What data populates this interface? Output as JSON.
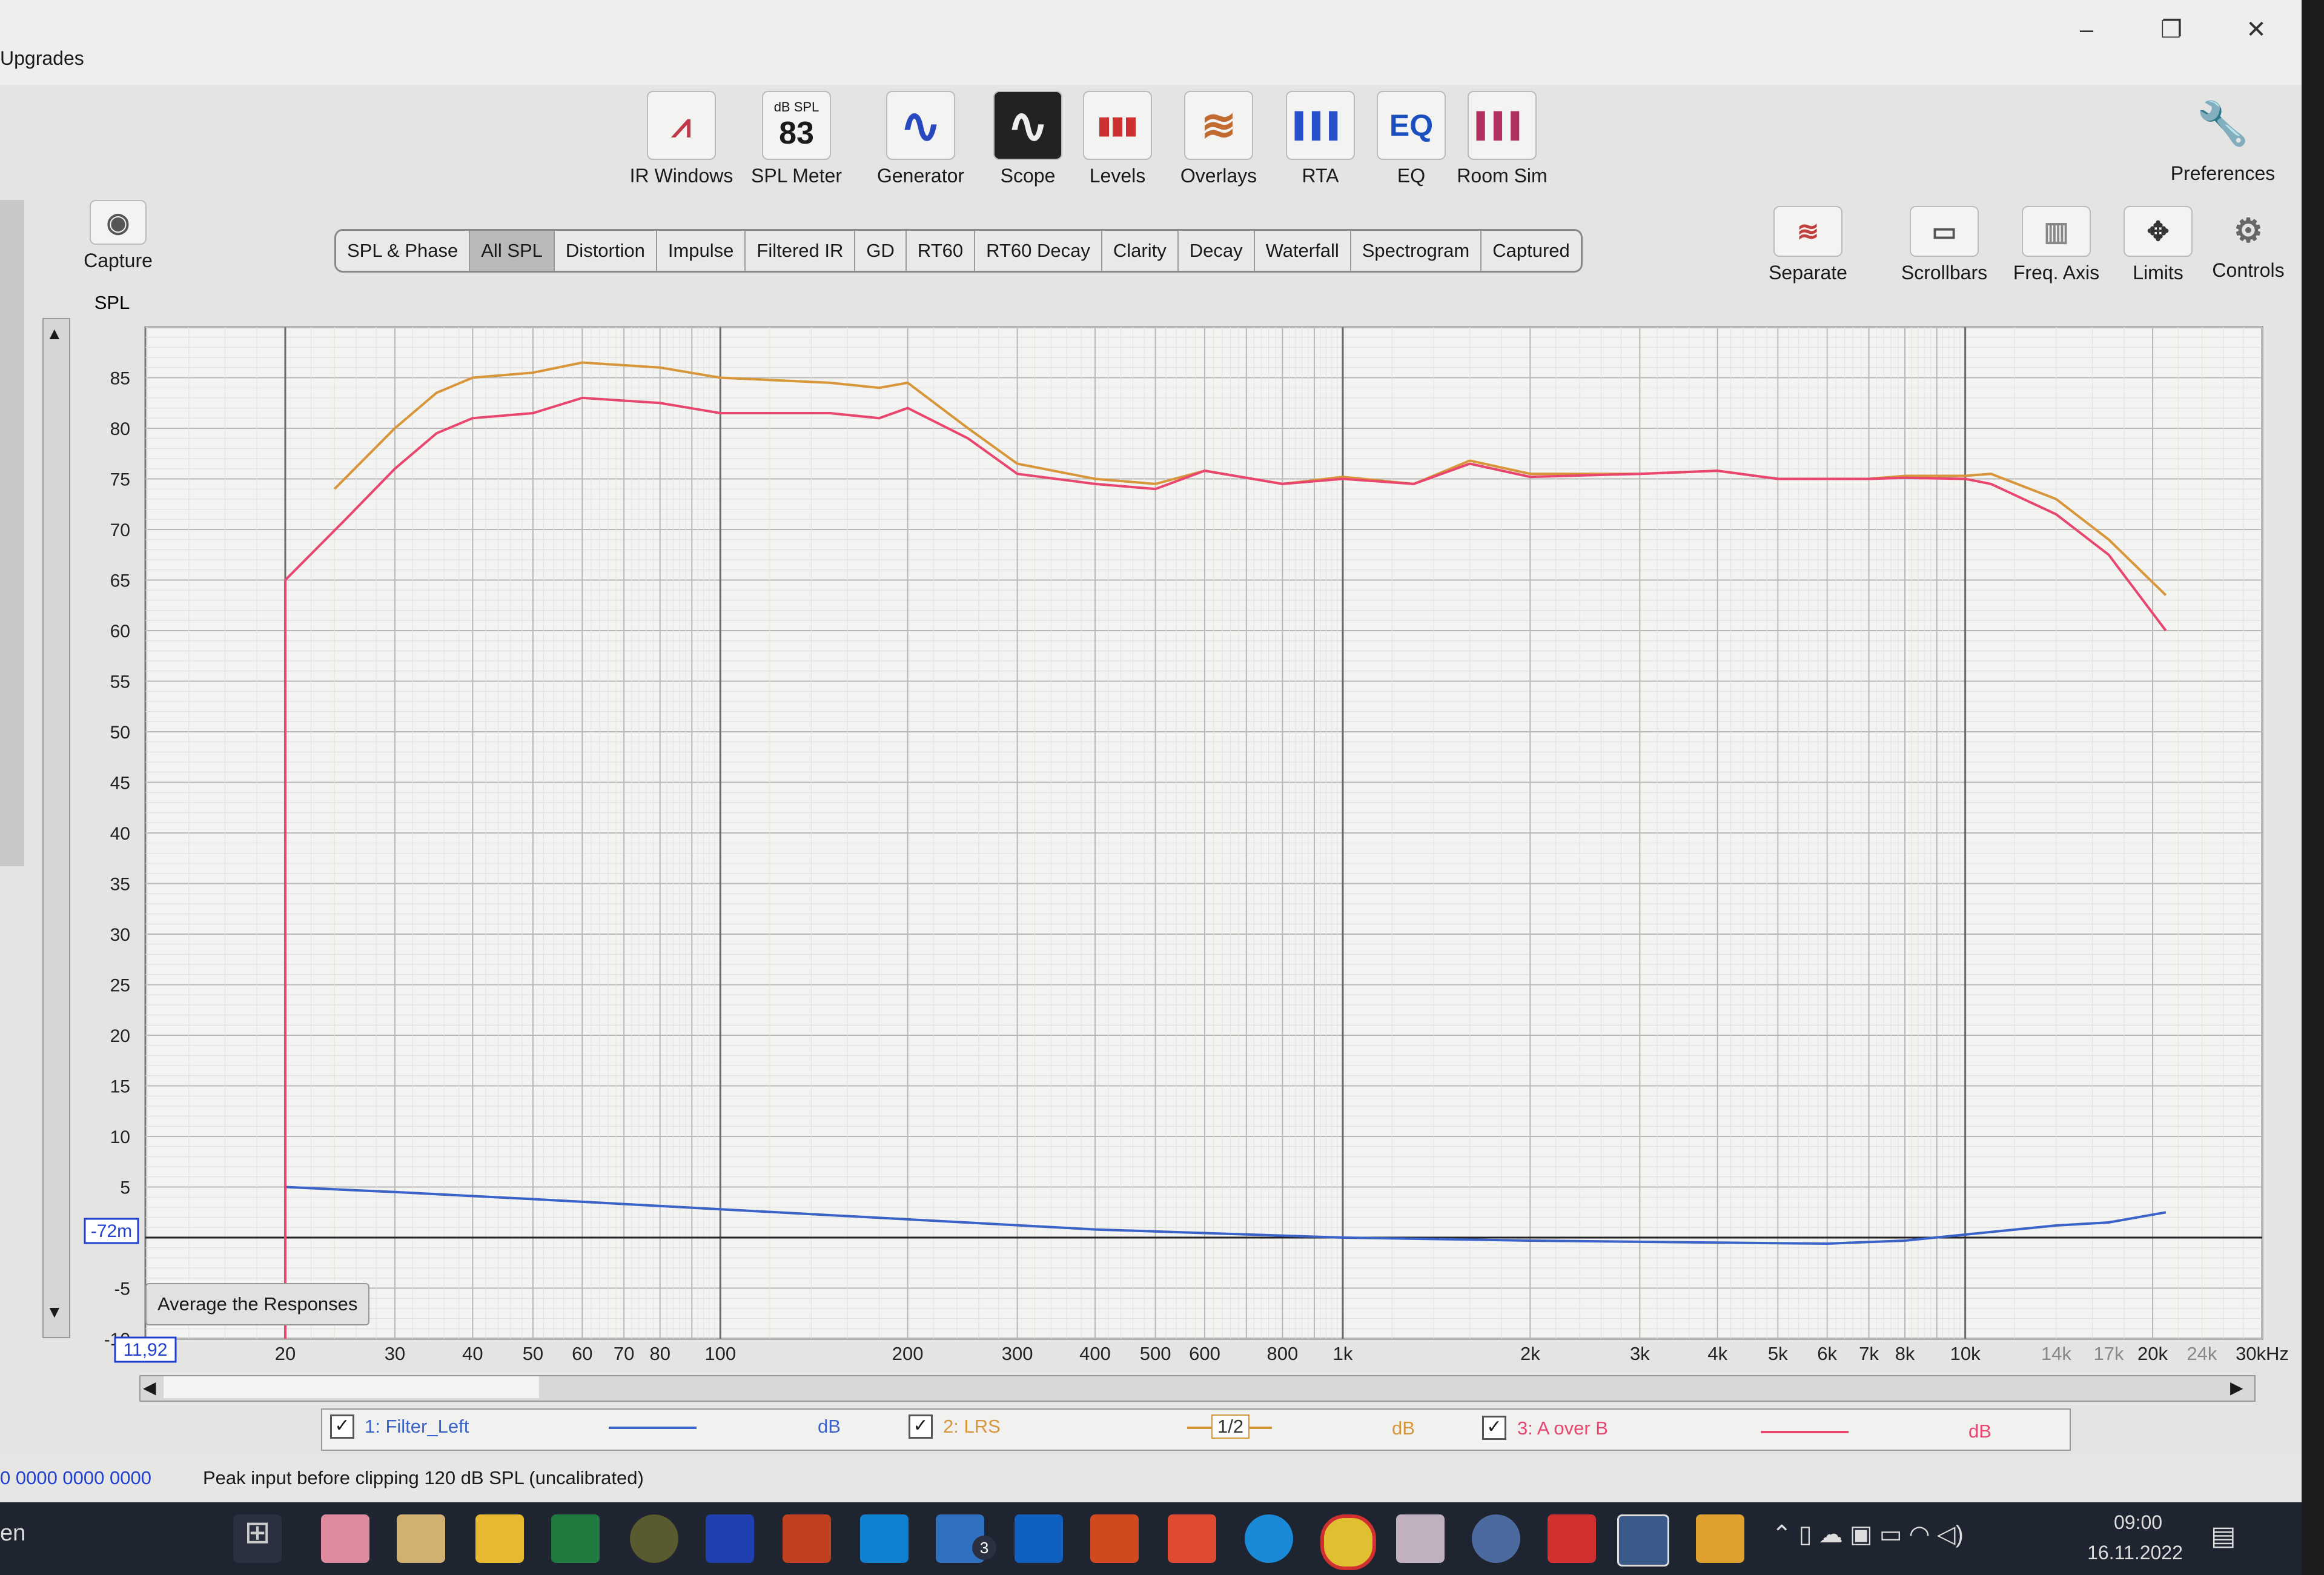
{
  "window": {
    "menu_item": "Upgrades",
    "controls": [
      "–",
      "❐",
      "✕"
    ]
  },
  "toolbar": {
    "tools": [
      {
        "icon": "ir-windows-icon",
        "label": "IR Windows",
        "glyph": "⩘"
      },
      {
        "icon": "spl-meter-icon",
        "label": "SPL Meter",
        "top": "dB SPL",
        "value": "83"
      },
      {
        "icon": "generator-icon",
        "label": "Generator",
        "glyph": "∿"
      },
      {
        "icon": "scope-icon",
        "label": "Scope",
        "glyph": "∿"
      },
      {
        "icon": "levels-icon",
        "label": "Levels",
        "glyph": "▮▮▮"
      },
      {
        "icon": "overlays-icon",
        "label": "Overlays",
        "glyph": "≋"
      },
      {
        "icon": "rta-icon",
        "label": "RTA",
        "glyph": "▌▌▌"
      },
      {
        "icon": "eq-icon",
        "label": "EQ",
        "glyph": "EQ"
      },
      {
        "icon": "room-sim-icon",
        "label": "Room Sim",
        "glyph": "▌▌▌"
      }
    ],
    "preferences": "Preferences",
    "capture": "Capture"
  },
  "tabs": [
    "SPL & Phase",
    "All SPL",
    "Distortion",
    "Impulse",
    "Filtered IR",
    "GD",
    "RT60",
    "RT60 Decay",
    "Clarity",
    "Decay",
    "Waterfall",
    "Spectrogram",
    "Captured"
  ],
  "active_tab": "All SPL",
  "graph_controls": [
    "Separate",
    "Scrollbars",
    "Freq. Axis",
    "Limits",
    "Controls"
  ],
  "graph_title": "SPL",
  "avg_button": "Average the Responses",
  "axis_readouts": {
    "left_marker": "-72m",
    "freq_start": "11,92"
  },
  "legend": [
    {
      "label": "1: Filter_Left",
      "unit": "dB",
      "color": "#3a62c8"
    },
    {
      "label": "2: LRS",
      "unit": "dB",
      "color": "#d8963a",
      "smoothing": "1/2"
    },
    {
      "label": "3: A over B",
      "unit": "dB",
      "color": "#e8466e"
    }
  ],
  "status": {
    "hex": "0 0000  0000 0000",
    "message": "Peak input before clipping 120 dB SPL (uncalibrated)"
  },
  "taskbar": {
    "lang": "en",
    "time": "09:00",
    "date": "16.11.2022",
    "badge": "3"
  },
  "chart_data": {
    "type": "line",
    "title": "",
    "ylabel": "SPL",
    "xlabel": "",
    "xscale": "log",
    "xlim": [
      11.92,
      30000
    ],
    "ylim": [
      -10,
      90
    ],
    "grid": true,
    "y_ticks": [
      "85",
      "80",
      "75",
      "70",
      "65",
      "60",
      "55",
      "50",
      "45",
      "40",
      "35",
      "30",
      "25",
      "20",
      "15",
      "10",
      "5",
      "-5",
      "-10"
    ],
    "x_ticks": [
      {
        "v": 20,
        "t": "20"
      },
      {
        "v": 30,
        "t": "30"
      },
      {
        "v": 40,
        "t": "40"
      },
      {
        "v": 50,
        "t": "50"
      },
      {
        "v": 60,
        "t": "60"
      },
      {
        "v": 70,
        "t": "70"
      },
      {
        "v": 80,
        "t": "80"
      },
      {
        "v": 100,
        "t": "100"
      },
      {
        "v": 200,
        "t": "200"
      },
      {
        "v": 300,
        "t": "300"
      },
      {
        "v": 400,
        "t": "400"
      },
      {
        "v": 500,
        "t": "500"
      },
      {
        "v": 600,
        "t": "600"
      },
      {
        "v": 800,
        "t": "800"
      },
      {
        "v": 1000,
        "t": "1k"
      },
      {
        "v": 2000,
        "t": "2k"
      },
      {
        "v": 3000,
        "t": "3k"
      },
      {
        "v": 4000,
        "t": "4k"
      },
      {
        "v": 5000,
        "t": "5k"
      },
      {
        "v": 6000,
        "t": "6k"
      },
      {
        "v": 7000,
        "t": "7k"
      },
      {
        "v": 8000,
        "t": "8k"
      },
      {
        "v": 10000,
        "t": "10k"
      },
      {
        "v": 14000,
        "t": "14k"
      },
      {
        "v": 17000,
        "t": "17k"
      },
      {
        "v": 20000,
        "t": "20k"
      },
      {
        "v": 24000,
        "t": "24k"
      },
      {
        "v": 30000,
        "t": "30kHz"
      }
    ],
    "series": [
      {
        "name": "1: Filter_Left",
        "color": "#3a62c8",
        "x": [
          20,
          30,
          50,
          100,
          200,
          400,
          800,
          1000,
          2000,
          4000,
          6000,
          8000,
          10000,
          14000,
          17000,
          21000
        ],
        "y": [
          5,
          4.5,
          3.8,
          2.8,
          1.8,
          0.8,
          0.2,
          0,
          -0.3,
          -0.5,
          -0.6,
          -0.3,
          0.3,
          1.2,
          1.5,
          2.5
        ]
      },
      {
        "name": "2: LRS",
        "color": "#d8963a",
        "x": [
          24,
          30,
          35,
          40,
          50,
          60,
          80,
          100,
          150,
          180,
          200,
          250,
          300,
          400,
          500,
          600,
          800,
          1000,
          1300,
          1600,
          2000,
          3000,
          4000,
          5000,
          7000,
          8000,
          10000,
          11000,
          14000,
          17000,
          21000
        ],
        "y": [
          74,
          80,
          83.5,
          85,
          85.5,
          86.5,
          86,
          85,
          84.5,
          84,
          84.5,
          80,
          76.5,
          75,
          74.5,
          75.8,
          74.5,
          75.2,
          74.5,
          76.8,
          75.5,
          75.5,
          75.8,
          75,
          75,
          75.3,
          75.3,
          75.5,
          73,
          69,
          63.5
        ]
      },
      {
        "name": "3: A over B",
        "color": "#e8466e",
        "x": [
          20,
          25,
          30,
          35,
          40,
          50,
          60,
          80,
          100,
          150,
          180,
          200,
          250,
          300,
          400,
          500,
          600,
          800,
          1000,
          1300,
          1600,
          2000,
          3000,
          4000,
          5000,
          7000,
          8000,
          10000,
          11000,
          14000,
          17000,
          21000
        ],
        "y": [
          65,
          71,
          76,
          79.5,
          81,
          81.5,
          83,
          82.5,
          81.5,
          81.5,
          81,
          82,
          79,
          75.5,
          74.5,
          74,
          75.8,
          74.5,
          75,
          74.5,
          76.5,
          75.2,
          75.5,
          75.8,
          75,
          75,
          75.1,
          75,
          74.5,
          71.5,
          67.5,
          60
        ]
      }
    ],
    "vertical_drop": {
      "x": 20,
      "from": 65,
      "to": -10
    }
  }
}
